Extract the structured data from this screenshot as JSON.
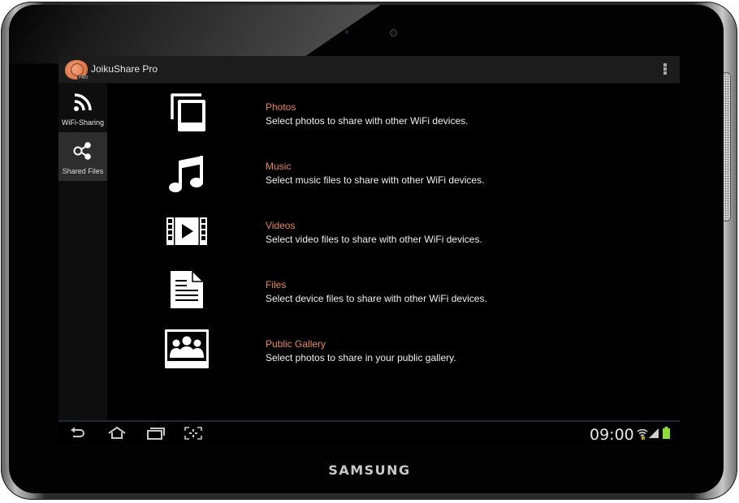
{
  "device": {
    "brand": "SAMSUNG"
  },
  "app": {
    "title": "JoikuShare Pro",
    "logo_badge": "PRO",
    "accent_color": "#e8895a"
  },
  "sidebar": {
    "items": [
      {
        "label": "WiFi-Sharing",
        "icon": "wifi-icon",
        "active": false
      },
      {
        "label": "Shared Files",
        "icon": "share-icon",
        "active": true
      }
    ]
  },
  "content": {
    "items": [
      {
        "title": "Photos",
        "description": "Select photos to share with other WiFi devices.",
        "icon": "photos-icon"
      },
      {
        "title": "Music",
        "description": "Select music files to share with other WiFi devices.",
        "icon": "music-icon"
      },
      {
        "title": "Videos",
        "description": "Select video files to share with other WiFi devices.",
        "icon": "video-icon"
      },
      {
        "title": "Files",
        "description": "Select device files to share with other WiFi devices.",
        "icon": "file-icon"
      },
      {
        "title": "Public Gallery",
        "description": "Select photos to share in your public gallery.",
        "icon": "gallery-icon"
      }
    ]
  },
  "navbar": {
    "buttons": [
      "back",
      "home",
      "recent-apps",
      "screenshot"
    ]
  },
  "status": {
    "time": "09:00",
    "battery_color": "#8ed93b"
  }
}
